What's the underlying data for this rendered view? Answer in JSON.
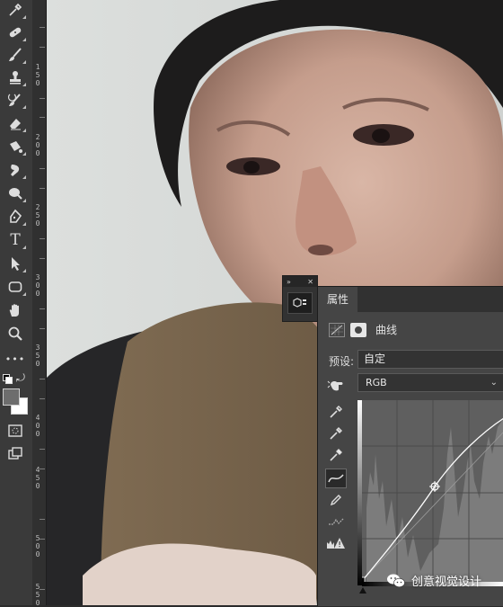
{
  "toolbar": {
    "tools": [
      {
        "name": "eyedropper-tool-icon"
      },
      {
        "name": "healing-brush-tool-icon"
      },
      {
        "name": "brush-tool-icon"
      },
      {
        "name": "clone-stamp-tool-icon"
      },
      {
        "name": "history-brush-tool-icon"
      },
      {
        "name": "eraser-tool-icon"
      },
      {
        "name": "gradient-tool-icon"
      },
      {
        "name": "blur-tool-icon"
      },
      {
        "name": "dodge-tool-icon"
      },
      {
        "name": "pen-tool-icon"
      },
      {
        "name": "type-tool-icon"
      },
      {
        "name": "path-selection-tool-icon"
      },
      {
        "name": "rectangle-tool-icon"
      },
      {
        "name": "hand-tool-icon"
      },
      {
        "name": "zoom-tool-icon"
      },
      {
        "name": "more-tools-icon"
      }
    ],
    "type_glyph": "T",
    "more_glyph": "•••"
  },
  "ruler": {
    "labels": [
      "150",
      "200",
      "250",
      "300",
      "350",
      "400",
      "450",
      "500",
      "550"
    ]
  },
  "properties": {
    "tab_label": "属性",
    "adjustment_title": "曲线",
    "preset_label": "预设:",
    "preset_value": "自定",
    "channel_value": "RGB"
  },
  "watermark": {
    "text": "创意视觉设计"
  },
  "colors": {
    "panel_bg": "#454545",
    "toolbar_bg": "#3a3a3a",
    "curve_line": "#ffffff"
  }
}
